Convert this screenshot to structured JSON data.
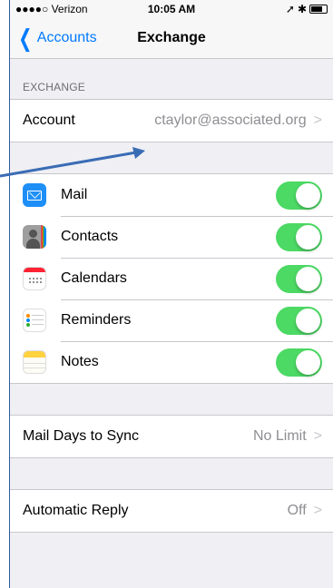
{
  "status_bar": {
    "carrier": "●●●●○ Verizon",
    "time": "10:05 AM"
  },
  "nav": {
    "back_label": "Accounts",
    "title": "Exchange"
  },
  "exchange_section": {
    "header": "EXCHANGE",
    "account_label": "Account",
    "account_value": "ctaylor@associated.org"
  },
  "sync_items": [
    {
      "label": "Mail",
      "icon": "mail-icon",
      "on": true
    },
    {
      "label": "Contacts",
      "icon": "contacts-icon",
      "on": true
    },
    {
      "label": "Calendars",
      "icon": "calendars-icon",
      "on": true
    },
    {
      "label": "Reminders",
      "icon": "reminders-icon",
      "on": true
    },
    {
      "label": "Notes",
      "icon": "notes-icon",
      "on": true
    }
  ],
  "mail_days": {
    "label": "Mail Days to Sync",
    "value": "No Limit"
  },
  "auto_reply": {
    "label": "Automatic Reply",
    "value": "Off"
  },
  "colors": {
    "accent": "#007aff",
    "toggle_on": "#4cd964",
    "arrow": "#3a6cb5"
  }
}
